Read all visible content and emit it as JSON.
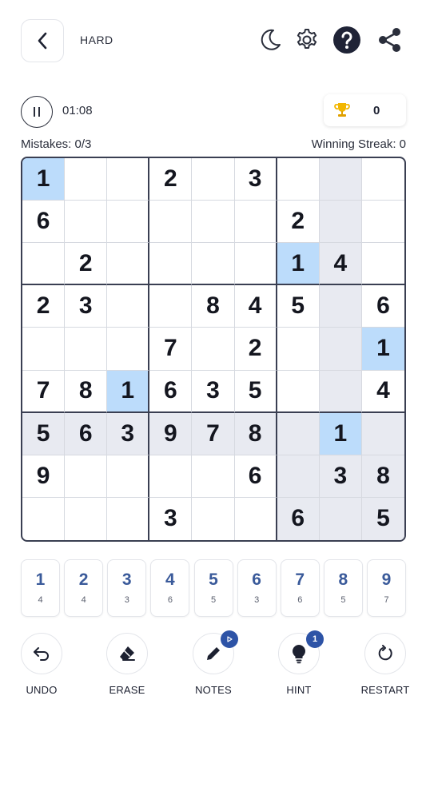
{
  "header": {
    "difficulty": "HARD",
    "icons": [
      "back-arrow-icon",
      "moon-icon",
      "gear-icon",
      "help-icon",
      "share-icon"
    ]
  },
  "status": {
    "timer": "01:08",
    "score": "0",
    "mistakes": "Mistakes: 0/3",
    "streak": "Winning Streak: 0"
  },
  "board": {
    "rows": [
      [
        "1",
        "",
        "",
        "2",
        "",
        "3",
        "",
        "",
        ""
      ],
      [
        "6",
        "",
        "",
        "",
        "",
        "",
        "2",
        "",
        ""
      ],
      [
        "",
        "2",
        "",
        "",
        "",
        "",
        "1",
        "4",
        ""
      ],
      [
        "2",
        "3",
        "",
        "",
        "8",
        "4",
        "5",
        "",
        "6"
      ],
      [
        "",
        "",
        "",
        "7",
        "",
        "2",
        "",
        "",
        "1"
      ],
      [
        "7",
        "8",
        "1",
        "6",
        "3",
        "5",
        "",
        "",
        "4"
      ],
      [
        "5",
        "6",
        "3",
        "9",
        "7",
        "8",
        "",
        "1",
        ""
      ],
      [
        "9",
        "",
        "",
        "",
        "",
        "6",
        "",
        "3",
        "8"
      ],
      [
        "",
        "",
        "",
        "3",
        "",
        "",
        "6",
        "",
        "5"
      ]
    ],
    "selected_value": "1",
    "highlight_row": 6,
    "highlight_col": 7,
    "highlight_box": [
      6,
      6
    ],
    "colors": {
      "selected": "#bcdcfb",
      "highlight": "#e8eaf1",
      "digit_key": "#3a5a9a",
      "badge": "#2d53a6"
    }
  },
  "numpad": [
    {
      "digit": "1",
      "count": "4"
    },
    {
      "digit": "2",
      "count": "4"
    },
    {
      "digit": "3",
      "count": "3"
    },
    {
      "digit": "4",
      "count": "6"
    },
    {
      "digit": "5",
      "count": "5"
    },
    {
      "digit": "6",
      "count": "3"
    },
    {
      "digit": "7",
      "count": "6"
    },
    {
      "digit": "8",
      "count": "5"
    },
    {
      "digit": "9",
      "count": "7"
    }
  ],
  "actions": {
    "undo": "UNDO",
    "erase": "ERASE",
    "notes": "NOTES",
    "hint": "HINT",
    "hint_badge": "1",
    "restart": "RESTART"
  }
}
